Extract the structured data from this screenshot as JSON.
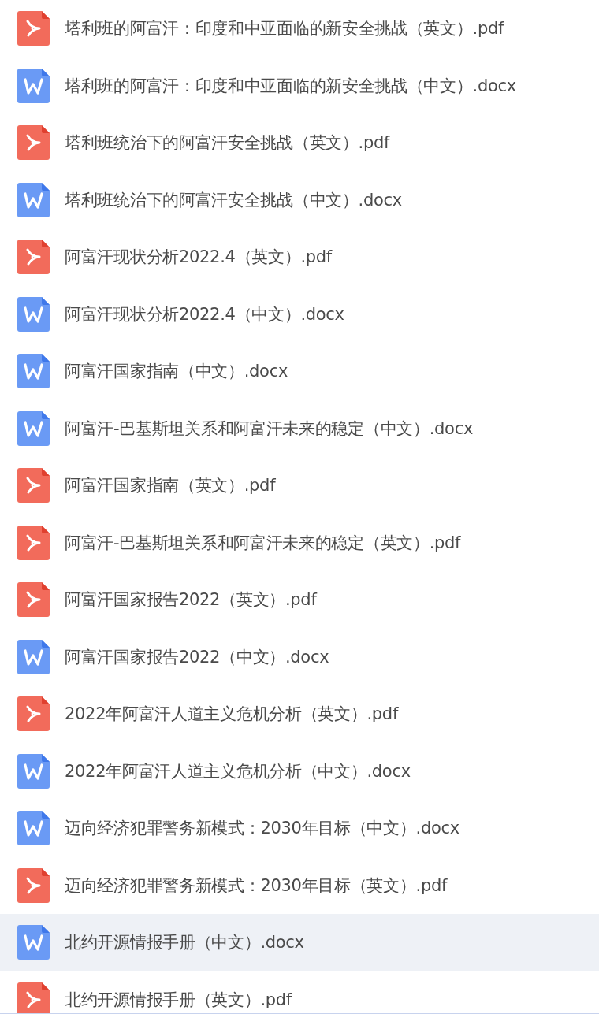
{
  "files": [
    {
      "name": "塔利班的阿富汗：印度和中亚面临的新安全挑战（英文）.pdf",
      "kind": "pdf",
      "selected": false
    },
    {
      "name": "塔利班的阿富汗：印度和中亚面临的新安全挑战（中文）.docx",
      "kind": "docx",
      "selected": false
    },
    {
      "name": "塔利班统治下的阿富汗安全挑战（英文）.pdf",
      "kind": "pdf",
      "selected": false
    },
    {
      "name": "塔利班统治下的阿富汗安全挑战（中文）.docx",
      "kind": "docx",
      "selected": false
    },
    {
      "name": "阿富汗现状分析2022.4（英文）.pdf",
      "kind": "pdf",
      "selected": false
    },
    {
      "name": "阿富汗现状分析2022.4（中文）.docx",
      "kind": "docx",
      "selected": false
    },
    {
      "name": "阿富汗国家指南（中文）.docx",
      "kind": "docx",
      "selected": false
    },
    {
      "name": "阿富汗-巴基斯坦关系和阿富汗未来的稳定（中文）.docx",
      "kind": "docx",
      "selected": false
    },
    {
      "name": "阿富汗国家指南（英文）.pdf",
      "kind": "pdf",
      "selected": false
    },
    {
      "name": "阿富汗-巴基斯坦关系和阿富汗未来的稳定（英文）.pdf",
      "kind": "pdf",
      "selected": false
    },
    {
      "name": "阿富汗国家报告2022（英文）.pdf",
      "kind": "pdf",
      "selected": false
    },
    {
      "name": "阿富汗国家报告2022（中文）.docx",
      "kind": "docx",
      "selected": false
    },
    {
      "name": "2022年阿富汗人道主义危机分析（英文）.pdf",
      "kind": "pdf",
      "selected": false
    },
    {
      "name": "2022年阿富汗人道主义危机分析（中文）.docx",
      "kind": "docx",
      "selected": false
    },
    {
      "name": "迈向经济犯罪警务新模式：2030年目标（中文）.docx",
      "kind": "docx",
      "selected": false
    },
    {
      "name": "迈向经济犯罪警务新模式：2030年目标（英文）.pdf",
      "kind": "pdf",
      "selected": false
    },
    {
      "name": "北约开源情报手册（中文）.docx",
      "kind": "docx",
      "selected": true
    },
    {
      "name": "北约开源情报手册（英文）.pdf",
      "kind": "pdf",
      "selected": false
    }
  ]
}
